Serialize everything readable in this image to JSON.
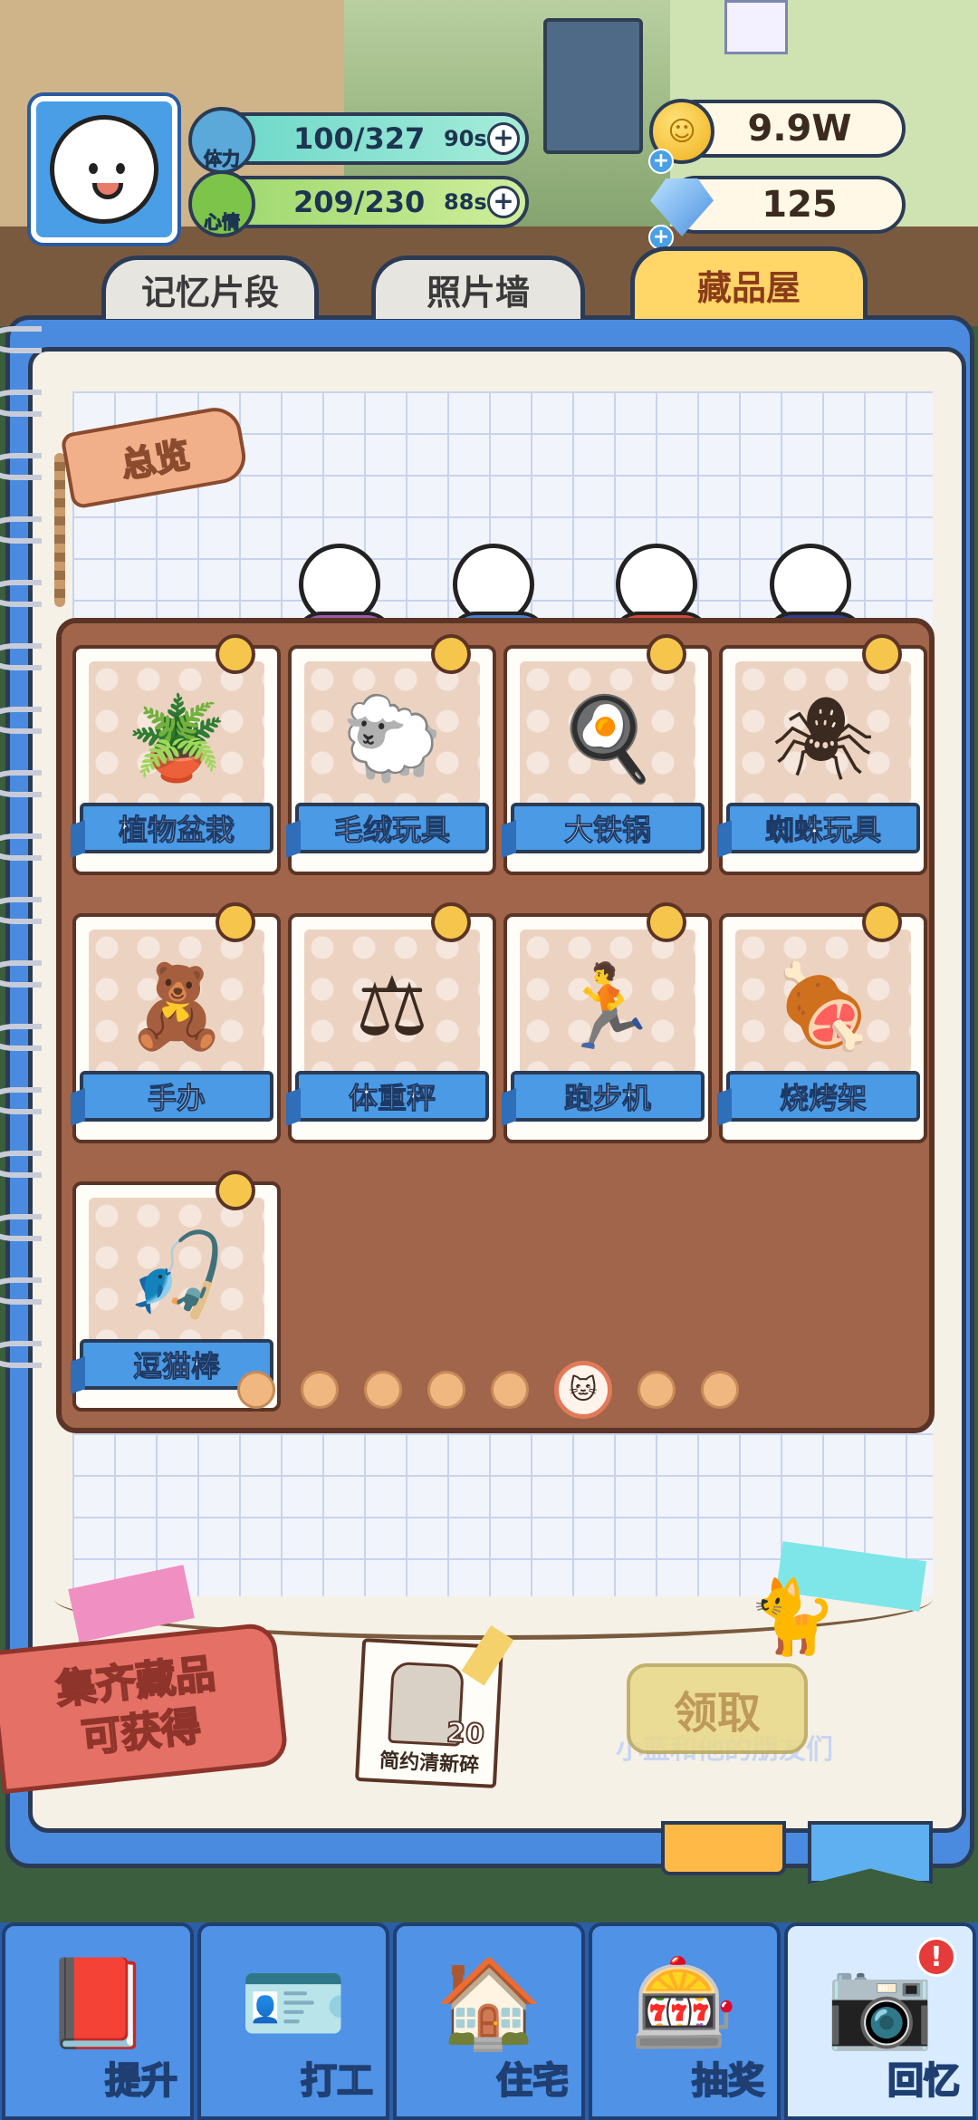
{
  "hud": {
    "stamina": {
      "label": "体力",
      "value": "100/327",
      "timer": "90s"
    },
    "mood": {
      "label": "心情",
      "value": "209/230",
      "timer": "88s"
    },
    "gold": "9.9W",
    "gems": "125"
  },
  "tabs": [
    {
      "label": "记忆片段"
    },
    {
      "label": "照片墙"
    },
    {
      "label": "藏品屋",
      "active": true
    }
  ],
  "overview_tag": "总览",
  "collection": {
    "items": [
      {
        "name": "植物盆栽",
        "icon": "potted-plant-icon",
        "glyph": "🪴"
      },
      {
        "name": "毛绒玩具",
        "icon": "plush-sheep-icon",
        "glyph": "🐑"
      },
      {
        "name": "大铁锅",
        "icon": "wok-icon",
        "glyph": "🍳"
      },
      {
        "name": "蜘蛛玩具",
        "icon": "spider-toy-icon",
        "glyph": "🕷"
      },
      {
        "name": "手办",
        "icon": "figure-icon",
        "glyph": "🧸"
      },
      {
        "name": "体重秤",
        "icon": "scale-icon",
        "glyph": "⚖"
      },
      {
        "name": "跑步机",
        "icon": "treadmill-icon",
        "glyph": "🏃"
      },
      {
        "name": "烧烤架",
        "icon": "grill-icon",
        "glyph": "🍖"
      },
      {
        "name": "逗猫棒",
        "icon": "cat-teaser-icon",
        "glyph": "🎣"
      }
    ],
    "page_count": 8,
    "current_page": 6
  },
  "reward": {
    "banner_line1": "集齐藏品",
    "banner_line2": "可获得",
    "item_name": "简约清新碎",
    "item_count": "20",
    "claim_label": "领取",
    "watermark": "小蓝和他的朋友们"
  },
  "nav": [
    {
      "label": "提升",
      "icon": "book-icon",
      "glyph": "📕"
    },
    {
      "label": "打工",
      "icon": "id-badge-icon",
      "glyph": "🪪"
    },
    {
      "label": "住宅",
      "icon": "house-icon",
      "glyph": "🏠"
    },
    {
      "label": "抽奖",
      "icon": "gacha-icon",
      "glyph": "🎰"
    },
    {
      "label": "回忆",
      "icon": "camera-icon",
      "glyph": "📷",
      "active": true,
      "alert": "!"
    }
  ],
  "colors": {
    "accent_blue": "#4a8be0",
    "shelf_brown": "#a0654a",
    "active_tab_yellow": "#ffd667",
    "ribbon_blue": "#4a9ae6"
  }
}
